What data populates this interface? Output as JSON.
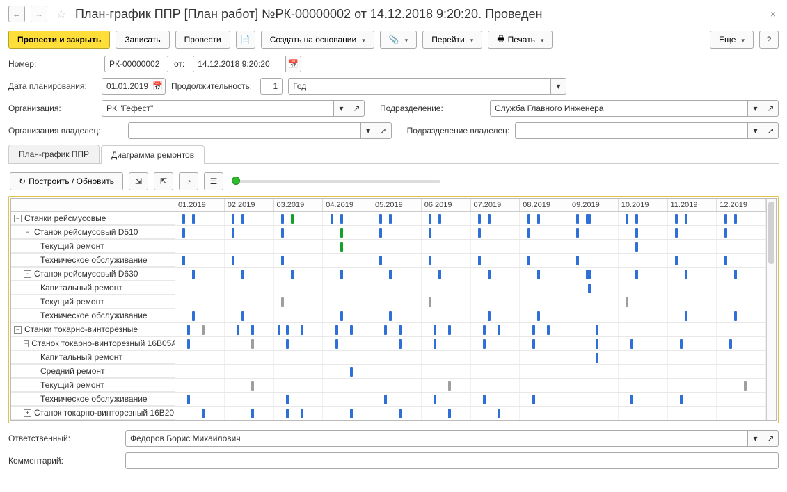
{
  "header": {
    "title": "План-график ППР [План работ] №РК-00000002 от 14.12.2018 9:20:20. Проведен"
  },
  "toolbar": {
    "post_close": "Провести и закрыть",
    "save": "Записать",
    "post": "Провести",
    "create_from": "Создать на основании",
    "goto": "Перейти",
    "print": "Печать",
    "more": "Еще"
  },
  "fields": {
    "number_label": "Номер:",
    "number_value": "РК-00000002",
    "from_label": "от:",
    "date_value": "14.12.2018  9:20:20",
    "plan_date_label": "Дата планирования:",
    "plan_date_value": "01.01.2019",
    "duration_label": "Продолжительность:",
    "duration_value": "1",
    "duration_unit": "Год",
    "org_label": "Организация:",
    "org_value": "РК \"Гефест\"",
    "dept_label": "Подразделение:",
    "dept_value": "Служба Главного Инженера",
    "owner_org_label": "Организация владелец:",
    "owner_org_value": "",
    "owner_dept_label": "Подразделение владелец:",
    "owner_dept_value": "",
    "responsible_label": "Ответственный:",
    "responsible_value": "Федоров Борис Михайлович",
    "comment_label": "Комментарий:",
    "comment_value": ""
  },
  "tabs": {
    "tab_schedule": "План-график ППР",
    "tab_diagram": "Диаграмма ремонтов"
  },
  "panel_toolbar": {
    "build": "Построить / Обновить"
  },
  "months": [
    "01.2019",
    "02.2019",
    "03.2019",
    "04.2019",
    "05.2019",
    "06.2019",
    "07.2019",
    "08.2019",
    "09.2019",
    "10.2019",
    "11.2019",
    "12.2019"
  ],
  "rows": [
    {
      "label": "Станки рейсмусовые",
      "indent": 0,
      "toggle": "minus",
      "bars": [
        [
          "b",
          15
        ],
        [
          "b",
          35
        ],
        [
          "b",
          15
        ],
        [
          "b",
          35
        ],
        [
          "b",
          15
        ],
        [
          "g",
          35
        ],
        [
          "b",
          15
        ],
        [
          "b",
          35
        ],
        [
          "b",
          15
        ],
        [
          "b",
          35
        ],
        [
          "b",
          15
        ],
        [
          "b",
          35
        ],
        [
          "b",
          15
        ],
        [
          "b",
          35
        ],
        [
          "b",
          15
        ],
        [
          "b",
          35
        ],
        [
          "b",
          15
        ],
        [
          "bw",
          35
        ],
        [
          "b",
          15
        ],
        [
          "b",
          35
        ],
        [
          "b",
          15
        ],
        [
          "b",
          35
        ],
        [
          "b",
          15
        ],
        [
          "b",
          35
        ]
      ]
    },
    {
      "label": "Станок рейсмусовый D510",
      "indent": 1,
      "toggle": "minus",
      "bars": [
        [
          "b",
          15
        ],
        [
          "b",
          15
        ],
        [
          "b",
          15
        ],
        [
          "g",
          35
        ],
        [
          "b",
          15
        ],
        [
          "b",
          15
        ],
        [
          "b",
          15
        ],
        [
          "b",
          15
        ],
        [
          "b",
          15
        ],
        [
          "b",
          35
        ],
        [
          "b",
          15
        ],
        [
          "b",
          15
        ]
      ]
    },
    {
      "label": "Текущий ремонт",
      "indent": 2,
      "bars": [
        [],
        [],
        [],
        [
          "g",
          35
        ],
        [],
        [],
        [],
        [],
        [],
        [
          "b",
          35
        ],
        [],
        []
      ]
    },
    {
      "label": "Техническое обслуживание",
      "indent": 2,
      "bars": [
        [
          "b",
          15
        ],
        [
          "b",
          15
        ],
        [
          "b",
          15
        ],
        [],
        [
          "b",
          15
        ],
        [
          "b",
          15
        ],
        [
          "b",
          15
        ],
        [
          "b",
          15
        ],
        [
          "b",
          15
        ],
        [],
        [
          "b",
          15
        ],
        [
          "b",
          15
        ]
      ]
    },
    {
      "label": "Станок рейсмусовый D630",
      "indent": 1,
      "toggle": "minus",
      "bars": [
        [
          "b",
          35
        ],
        [
          "b",
          35
        ],
        [
          "b",
          35
        ],
        [
          "b",
          35
        ],
        [
          "b",
          35
        ],
        [
          "b",
          35
        ],
        [
          "b",
          35
        ],
        [
          "b",
          35
        ],
        [
          "bw",
          35
        ],
        [
          "b",
          35
        ],
        [
          "b",
          35
        ],
        [
          "b",
          35
        ]
      ]
    },
    {
      "label": "Капитальный ремонт",
      "indent": 2,
      "bars": [
        [],
        [],
        [],
        [],
        [],
        [],
        [],
        [],
        [
          "b",
          38
        ],
        [],
        [],
        []
      ]
    },
    {
      "label": "Текущий ремонт",
      "indent": 2,
      "bars": [
        [],
        [],
        [
          "gr",
          15
        ],
        [],
        [],
        [
          "gr",
          15
        ],
        [],
        [],
        [],
        [
          "gr",
          15
        ],
        [],
        []
      ]
    },
    {
      "label": "Техническое обслуживание",
      "indent": 2,
      "bars": [
        [
          "b",
          35
        ],
        [
          "b",
          35
        ],
        [],
        [
          "b",
          35
        ],
        [
          "b",
          35
        ],
        [],
        [
          "b",
          35
        ],
        [
          "b",
          35
        ],
        [],
        [],
        [
          "b",
          35
        ],
        [
          "b",
          35
        ]
      ]
    },
    {
      "label": "Станки токарно-винторезные",
      "indent": 0,
      "toggle": "minus",
      "bars": [
        [
          "b",
          25
        ],
        [
          "gr",
          55
        ],
        [
          "b",
          25
        ],
        [
          "b",
          55
        ],
        [
          "b",
          25
        ],
        [
          "b",
          55
        ],
        [
          "b",
          25
        ],
        [
          "b",
          55
        ],
        [
          "b",
          8
        ],
        [
          "b",
          25
        ],
        [
          "b",
          55
        ],
        [
          "b",
          25
        ],
        [
          "b",
          55
        ],
        [
          "b",
          25
        ],
        [
          "b",
          55
        ],
        [
          "b",
          25
        ],
        [
          "b",
          55
        ],
        [
          "b",
          25
        ],
        [
          "b",
          55
        ],
        [
          "b",
          25
        ],
        [
          "b",
          55
        ],
        [
          "b",
          25
        ],
        [
          "b",
          55
        ],
        [
          "b",
          25
        ],
        [
          "b",
          55
        ]
      ]
    },
    {
      "label": "Станок токарно-винторезный 16В05А",
      "indent": 1,
      "toggle": "minus",
      "bars": [
        [
          "b",
          25
        ],
        [
          "gr",
          55
        ],
        [
          "b",
          25
        ],
        [
          "b",
          25
        ],
        [
          "b",
          55
        ],
        [
          "b",
          25
        ],
        [
          "b",
          25
        ],
        [
          "b",
          25
        ],
        [
          "b",
          55
        ],
        [
          "b",
          25
        ],
        [
          "b",
          25
        ],
        [
          "b",
          25
        ]
      ]
    },
    {
      "label": "Капитальный ремонт",
      "indent": 2,
      "bars": [
        [],
        [],
        [],
        [],
        [],
        [],
        [],
        [],
        [
          "b",
          55
        ],
        [],
        [],
        []
      ]
    },
    {
      "label": "Средний ремонт",
      "indent": 2,
      "bars": [
        [],
        [],
        [],
        [
          "b",
          55
        ],
        [],
        [],
        [],
        [],
        [],
        [],
        [],
        []
      ]
    },
    {
      "label": "Текущий ремонт",
      "indent": 2,
      "bars": [
        [],
        [
          "gr",
          55
        ],
        [],
        [],
        [],
        [
          "gr",
          55
        ],
        [],
        [],
        [],
        [],
        [],
        [
          "gr",
          55
        ]
      ]
    },
    {
      "label": "Техническое обслуживание",
      "indent": 2,
      "bars": [
        [
          "b",
          25
        ],
        [],
        [
          "b",
          25
        ],
        [],
        [
          "b",
          25
        ],
        [
          "b",
          25
        ],
        [
          "b",
          25
        ],
        [
          "b",
          25
        ],
        [],
        [
          "b",
          25
        ],
        [
          "b",
          25
        ],
        []
      ]
    },
    {
      "label": "Станок токарно-винторезный 16В20",
      "indent": 1,
      "toggle": "plus",
      "bars": [
        [
          "b",
          55
        ],
        [
          "b",
          55
        ],
        [
          "b",
          55
        ],
        [
          "b",
          55
        ],
        [
          "b",
          25
        ],
        [
          "b",
          55
        ],
        [
          "b",
          55
        ],
        [
          "b",
          55
        ],
        [
          "b",
          55
        ],
        [
          "b",
          55
        ],
        [
          "b",
          55
        ],
        [
          "b",
          55
        ],
        [
          "b",
          55
        ]
      ]
    }
  ]
}
